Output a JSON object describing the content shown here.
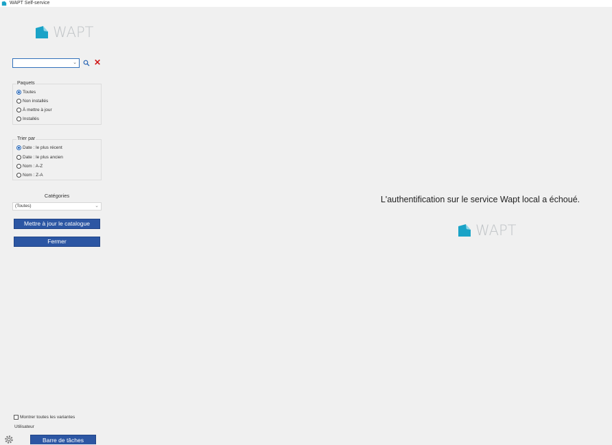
{
  "window": {
    "title": "WAPT Self-service"
  },
  "logo": {
    "text": "WAPT"
  },
  "search": {
    "value": ""
  },
  "packages_group": {
    "title": "Paquets",
    "options": [
      "Toutes",
      "Non installés",
      "À mettre à jour",
      "Installés"
    ],
    "selected": "Toutes"
  },
  "sort_group": {
    "title": "Trier par",
    "options": [
      "Date : le plus récent",
      "Date : le plus ancien",
      "Nom : A-Z",
      "Nom : Z-A"
    ],
    "selected": "Date : le plus récent"
  },
  "categories": {
    "label": "Catégories",
    "selected": "(Toutes)"
  },
  "buttons": {
    "update_catalog": "Mettre à jour le catalogue",
    "close": "Fermer",
    "taskbar": "Barre de tâches"
  },
  "show_variants": {
    "label": "Montrer toutes les variantes",
    "checked": false
  },
  "user": {
    "label": "Utilisateur"
  },
  "main": {
    "message": "L'authentification sur le service Wapt local a échoué."
  },
  "colors": {
    "accent": "#2c56a3",
    "logo_teal": "#1aa3c7",
    "clear_red": "#d01818"
  }
}
